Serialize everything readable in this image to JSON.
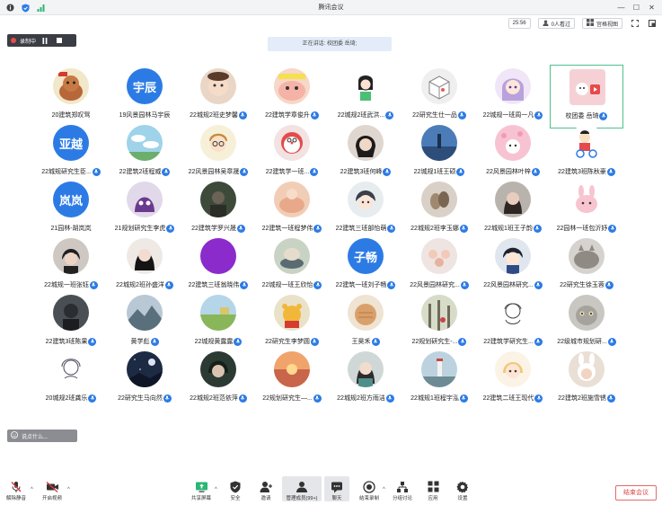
{
  "window": {
    "title": "腾讯会议",
    "time": "25:56",
    "viewer_count": "0人看过",
    "view_mode": "宫格视图"
  },
  "recording": {
    "label": "录制中"
  },
  "speaking": "正在讲话: 校团委 岳琦;",
  "participants": [
    {
      "name": "20建筑郑叹驽",
      "mic": false,
      "style": "cat"
    },
    {
      "name": "19风景园林马宇辰",
      "mic": false,
      "avatar_text": "宇辰",
      "color": "#2c7be5"
    },
    {
      "name": "22城规2班史梦馨",
      "mic": true,
      "style": "baby"
    },
    {
      "name": "22建筑学章俊升",
      "mic": true,
      "style": "cartoon-pink"
    },
    {
      "name": "22城规2班武洪...",
      "mic": true,
      "style": "girl-sketch"
    },
    {
      "name": "22研究生仕一品",
      "mic": true,
      "style": "box"
    },
    {
      "name": "22城规一班周一凡",
      "mic": true,
      "style": "anime-girl"
    },
    {
      "name": "校团委 岳琦",
      "mic": true,
      "style": "pink-logo",
      "active": true
    },
    {
      "name": "22城规研究生臣...",
      "mic": true,
      "avatar_text": "亚越",
      "color": "#2c7be5"
    },
    {
      "name": "22建筑2班程威",
      "mic": true,
      "style": "sky"
    },
    {
      "name": "22风景园林吴章晟",
      "mic": true,
      "style": "boy-cartoon"
    },
    {
      "name": "22建筑学一班...",
      "mic": true,
      "style": "doraemon"
    },
    {
      "name": "22建筑3班何峰",
      "mic": true,
      "style": "dark-hair"
    },
    {
      "name": "22城规1班王硕",
      "mic": true,
      "style": "blue-photo"
    },
    {
      "name": "22风景园林叶梓",
      "mic": true,
      "style": "pink-dots"
    },
    {
      "name": "22建筑3班陈秋豪",
      "mic": true,
      "style": "crayon"
    },
    {
      "name": "21园林-胡岚岚",
      "mic": false,
      "avatar_text": "岚岚",
      "color": "#2c7be5"
    },
    {
      "name": "21规划研究生李虎",
      "mic": true,
      "style": "purple-ghost"
    },
    {
      "name": "22建筑学罗兴晟",
      "mic": true,
      "style": "dark-green"
    },
    {
      "name": "22建筑一班程梦伟",
      "mic": true,
      "style": "peach"
    },
    {
      "name": "22建筑三班部怡萌",
      "mic": true,
      "style": "anime-boy"
    },
    {
      "name": "22城规2班李玉娜",
      "mic": true,
      "style": "hands"
    },
    {
      "name": "22城规1班王子韵",
      "mic": true,
      "style": "woman-dark"
    },
    {
      "name": "22园林一班包沂妤",
      "mic": true,
      "style": "pink-bunny"
    },
    {
      "name": "22城规一班张钰",
      "mic": true,
      "style": "kpop"
    },
    {
      "name": "22城规2班孙盛洋",
      "mic": true,
      "style": "girl-black"
    },
    {
      "name": "22建筑三班翁晓伟",
      "mic": true,
      "style": "purple"
    },
    {
      "name": "22城规一班王欣怡",
      "mic": true,
      "style": "dog-bowl"
    },
    {
      "name": "22建筑一班刘子畅",
      "mic": true,
      "avatar_text": "子畅",
      "color": "#2c7be5"
    },
    {
      "name": "22风景园林研究...",
      "mic": true,
      "style": "crowd"
    },
    {
      "name": "22风景园林研究...",
      "mic": true,
      "style": "conan"
    },
    {
      "name": "22研究生徐玉蓉",
      "mic": true,
      "style": "cat-sleep"
    },
    {
      "name": "22建筑3班陈果",
      "mic": true,
      "style": "man-dark"
    },
    {
      "name": "黄学彪",
      "mic": true,
      "style": "mountain"
    },
    {
      "name": "22城规黄露露",
      "mic": true,
      "style": "landscape-green"
    },
    {
      "name": "22研究生李梦圆",
      "mic": true,
      "style": "winnie"
    },
    {
      "name": "王昊禾",
      "mic": true,
      "style": "bread"
    },
    {
      "name": "22规划研究生-...",
      "mic": true,
      "style": "woods"
    },
    {
      "name": "22建筑学研究生...",
      "mic": true,
      "style": "sketch-girl"
    },
    {
      "name": "22级城市规划研...",
      "mic": true,
      "style": "gray-cat"
    },
    {
      "name": "20城规2班龚乐",
      "mic": true,
      "style": "line-girl"
    },
    {
      "name": "22研究生马向然",
      "mic": true,
      "style": "night-sky"
    },
    {
      "name": "22城规2班范依萍",
      "mic": true,
      "style": "anime-dark"
    },
    {
      "name": "22规划研究生—...",
      "mic": true,
      "style": "sunset"
    },
    {
      "name": "22城规2班方雨洁",
      "mic": true,
      "style": "girl-teal"
    },
    {
      "name": "22城规1班程宇泓",
      "mic": true,
      "style": "lighthouse"
    },
    {
      "name": "22建筑二班王现代",
      "mic": true,
      "style": "cute-girl"
    },
    {
      "name": "22建筑2班施雪锈",
      "mic": true,
      "style": "bunny-hat"
    }
  ],
  "chat": {
    "placeholder": "说点什么..."
  },
  "toolbar": {
    "mute": "解除静音",
    "video": "开启视频",
    "share": "共享屏幕",
    "security": "安全",
    "invite": "邀请",
    "members": "管理成员(99+)",
    "chat": "聊天",
    "record": "结束录制",
    "breakout": "分组讨论",
    "apps": "应用",
    "settings": "设置",
    "end": "结束会议"
  }
}
